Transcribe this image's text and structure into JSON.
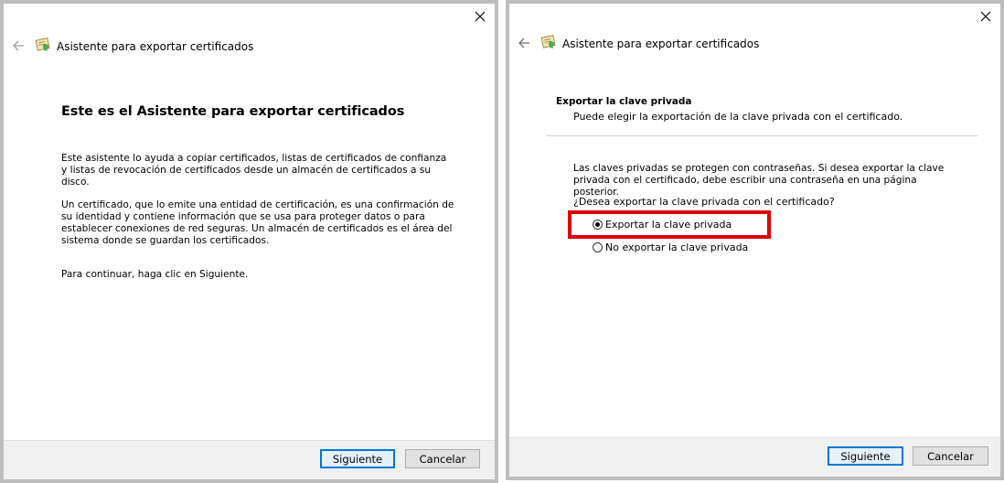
{
  "left_window": {
    "title": "Asistente para exportar certificados",
    "heading": "Este es el Asistente para exportar certificados",
    "paragraphs": [
      "Este asistente lo ayuda a copiar certificados, listas de certificados de confianza y listas de revocación de certificados desde un almacén de certificados a su disco.",
      "Un certificado, que lo emite una entidad de certificación, es una confirmación de su identidad y contiene información que se usa para proteger datos o para establecer conexiones de red seguras. Un almacén de certificados es el área del sistema donde se guardan los certificados.",
      "Para continuar, haga clic en Siguiente."
    ],
    "next_label": "Siguiente",
    "cancel_label": "Cancelar"
  },
  "right_window": {
    "title": "Asistente para exportar certificados",
    "section_title": "Exportar la clave privada",
    "section_desc": "Puede elegir la exportación de la clave privada con el certificado.",
    "paragraph": "Las claves privadas se protegen con contraseñas. Si desea exportar la clave privada con el certificado, debe escribir una contraseña en una página posterior.",
    "question": "¿Desea exportar la clave privada con el certificado?",
    "options": [
      {
        "label": "Exportar la clave privada",
        "selected": true
      },
      {
        "label": "No exportar la clave privada",
        "selected": false
      }
    ],
    "next_label": "Siguiente",
    "cancel_label": "Cancelar"
  },
  "icons": {
    "close": "close-icon",
    "back": "back-arrow-icon",
    "wizard": "certificate-icon"
  },
  "colors": {
    "highlight": "#e00000",
    "primary_button_border": "#0078d7",
    "footer": "#f0f0f0",
    "frame": "#bdbdbd"
  }
}
